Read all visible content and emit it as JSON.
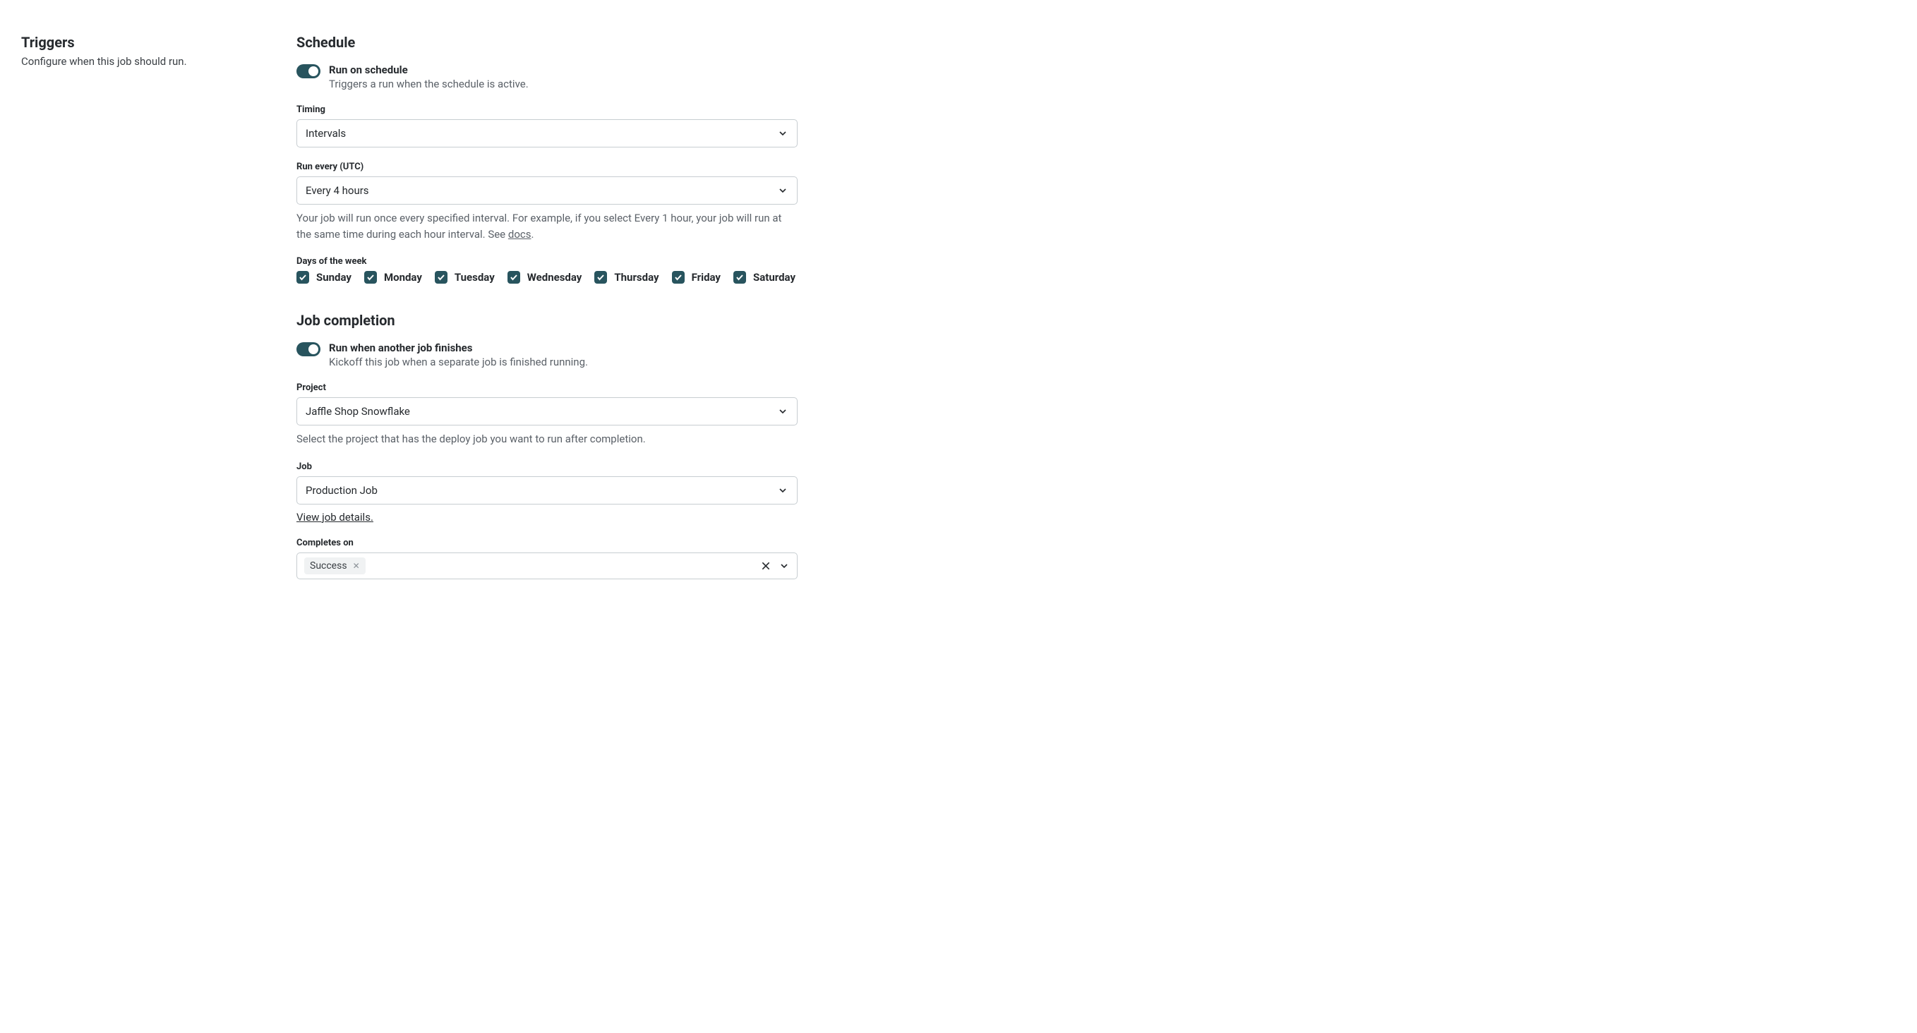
{
  "sidebar": {
    "title": "Triggers",
    "description": "Configure when this job should run."
  },
  "schedule": {
    "title": "Schedule",
    "toggle": {
      "title": "Run on schedule",
      "description": "Triggers a run when the schedule is active."
    },
    "timing": {
      "label": "Timing",
      "value": "Intervals"
    },
    "run_every": {
      "label": "Run every (UTC)",
      "value": "Every 4 hours",
      "helper_pre": "Your job will run once every specified interval. For example, if you select Every 1 hour, your job will run at the same time during each hour interval. See ",
      "docs_label": "docs",
      "helper_post": "."
    },
    "days": {
      "label": "Days of the week",
      "items": [
        "Sunday",
        "Monday",
        "Tuesday",
        "Wednesday",
        "Thursday",
        "Friday",
        "Saturday"
      ]
    }
  },
  "completion": {
    "title": "Job completion",
    "toggle": {
      "title": "Run when another job finishes",
      "description": "Kickoff this job when a separate job is finished running."
    },
    "project": {
      "label": "Project",
      "value": "Jaffle Shop Snowflake",
      "helper": "Select the project that has the deploy job you want to run after completion."
    },
    "job": {
      "label": "Job",
      "value": "Production Job",
      "link": "View job details."
    },
    "completes_on": {
      "label": "Completes on",
      "tag": "Success"
    }
  }
}
